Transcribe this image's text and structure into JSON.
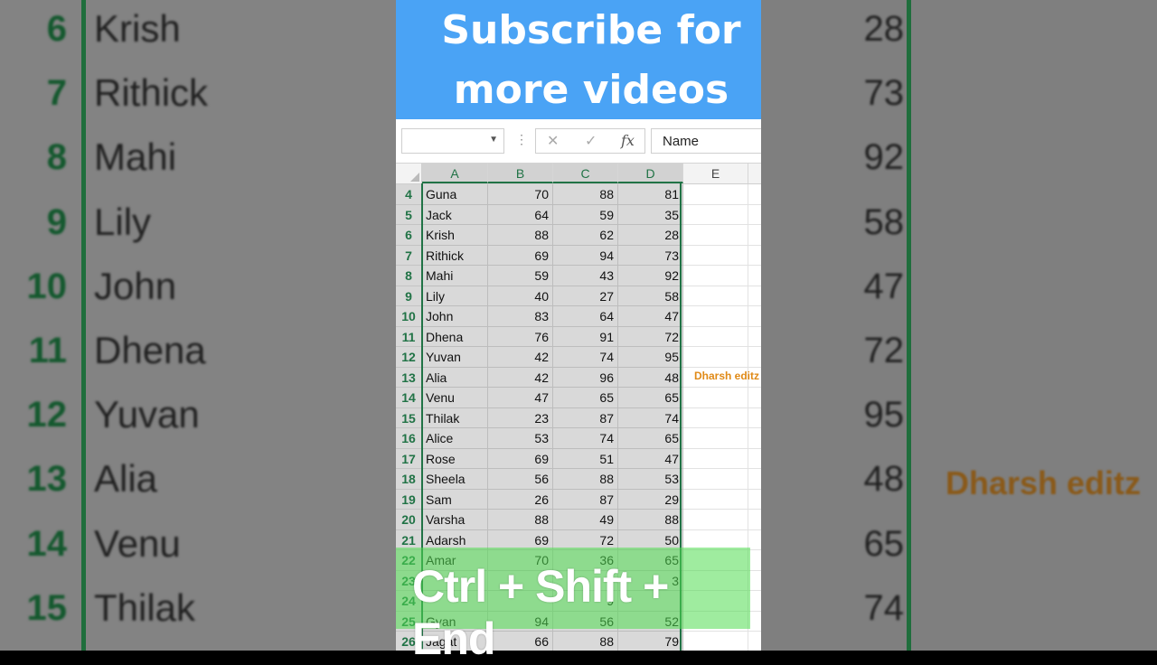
{
  "banner": {
    "line1": "Subscribe for",
    "line2": "more videos"
  },
  "formula_bar": {
    "name_box": "",
    "cancel_symbol": "✕",
    "enter_symbol": "✓",
    "fx_symbol": "fx",
    "content": "Name"
  },
  "columns": [
    "A",
    "B",
    "C",
    "D",
    "E"
  ],
  "rows": [
    {
      "n": "4",
      "name": "Guna",
      "b": "70",
      "c": "88",
      "d": "81"
    },
    {
      "n": "5",
      "name": "Jack",
      "b": "64",
      "c": "59",
      "d": "35"
    },
    {
      "n": "6",
      "name": "Krish",
      "b": "88",
      "c": "62",
      "d": "28"
    },
    {
      "n": "7",
      "name": "Rithick",
      "b": "69",
      "c": "94",
      "d": "73"
    },
    {
      "n": "8",
      "name": "Mahi",
      "b": "59",
      "c": "43",
      "d": "92"
    },
    {
      "n": "9",
      "name": "Lily",
      "b": "40",
      "c": "27",
      "d": "58"
    },
    {
      "n": "10",
      "name": "John",
      "b": "83",
      "c": "64",
      "d": "47"
    },
    {
      "n": "11",
      "name": "Dhena",
      "b": "76",
      "c": "91",
      "d": "72"
    },
    {
      "n": "12",
      "name": "Yuvan",
      "b": "42",
      "c": "74",
      "d": "95"
    },
    {
      "n": "13",
      "name": "Alia",
      "b": "42",
      "c": "96",
      "d": "48"
    },
    {
      "n": "14",
      "name": "Venu",
      "b": "47",
      "c": "65",
      "d": "65"
    },
    {
      "n": "15",
      "name": "Thilak",
      "b": "23",
      "c": "87",
      "d": "74"
    },
    {
      "n": "16",
      "name": "Alice",
      "b": "53",
      "c": "74",
      "d": "65"
    },
    {
      "n": "17",
      "name": "Rose",
      "b": "69",
      "c": "51",
      "d": "47"
    },
    {
      "n": "18",
      "name": "Sheela",
      "b": "56",
      "c": "88",
      "d": "53"
    },
    {
      "n": "19",
      "name": "Sam",
      "b": "26",
      "c": "87",
      "d": "29"
    },
    {
      "n": "20",
      "name": "Varsha",
      "b": "88",
      "c": "49",
      "d": "88"
    },
    {
      "n": "21",
      "name": "Adarsh",
      "b": "69",
      "c": "72",
      "d": "50"
    },
    {
      "n": "22",
      "name": "Amar",
      "b": "70",
      "c": "36",
      "d": "65"
    },
    {
      "n": "23",
      "name": "",
      "b": "",
      "c": "",
      "d": "3"
    },
    {
      "n": "24",
      "name": "",
      "b": "",
      "c": "9",
      "d": ""
    },
    {
      "n": "25",
      "name": "Gyan",
      "b": "94",
      "c": "56",
      "d": "52"
    },
    {
      "n": "26",
      "name": "Jagat",
      "b": "66",
      "c": "88",
      "d": "79"
    }
  ],
  "watermark": "Dharsh editz",
  "shortcut_caption": "Ctrl + Shift + End",
  "background": {
    "rows": [
      {
        "n": "6",
        "name": "Krish",
        "val": "28"
      },
      {
        "n": "7",
        "name": "Rithick",
        "val": "73"
      },
      {
        "n": "8",
        "name": "Mahi",
        "val": "92"
      },
      {
        "n": "9",
        "name": "Lily",
        "val": "58"
      },
      {
        "n": "10",
        "name": "John",
        "val": "47"
      },
      {
        "n": "11",
        "name": "Dhena",
        "val": "72"
      },
      {
        "n": "12",
        "name": "Yuvan",
        "val": "95"
      },
      {
        "n": "13",
        "name": "Alia",
        "val": "48"
      },
      {
        "n": "14",
        "name": "Venu",
        "val": "65"
      },
      {
        "n": "15",
        "name": "Thilak",
        "val": "74"
      }
    ],
    "watermark": "Dharsh editz"
  },
  "colors": {
    "banner": "#4aa3f5",
    "excel_green": "#217346",
    "watermark": "#e08a17",
    "caption_bg": "#50dc50"
  }
}
